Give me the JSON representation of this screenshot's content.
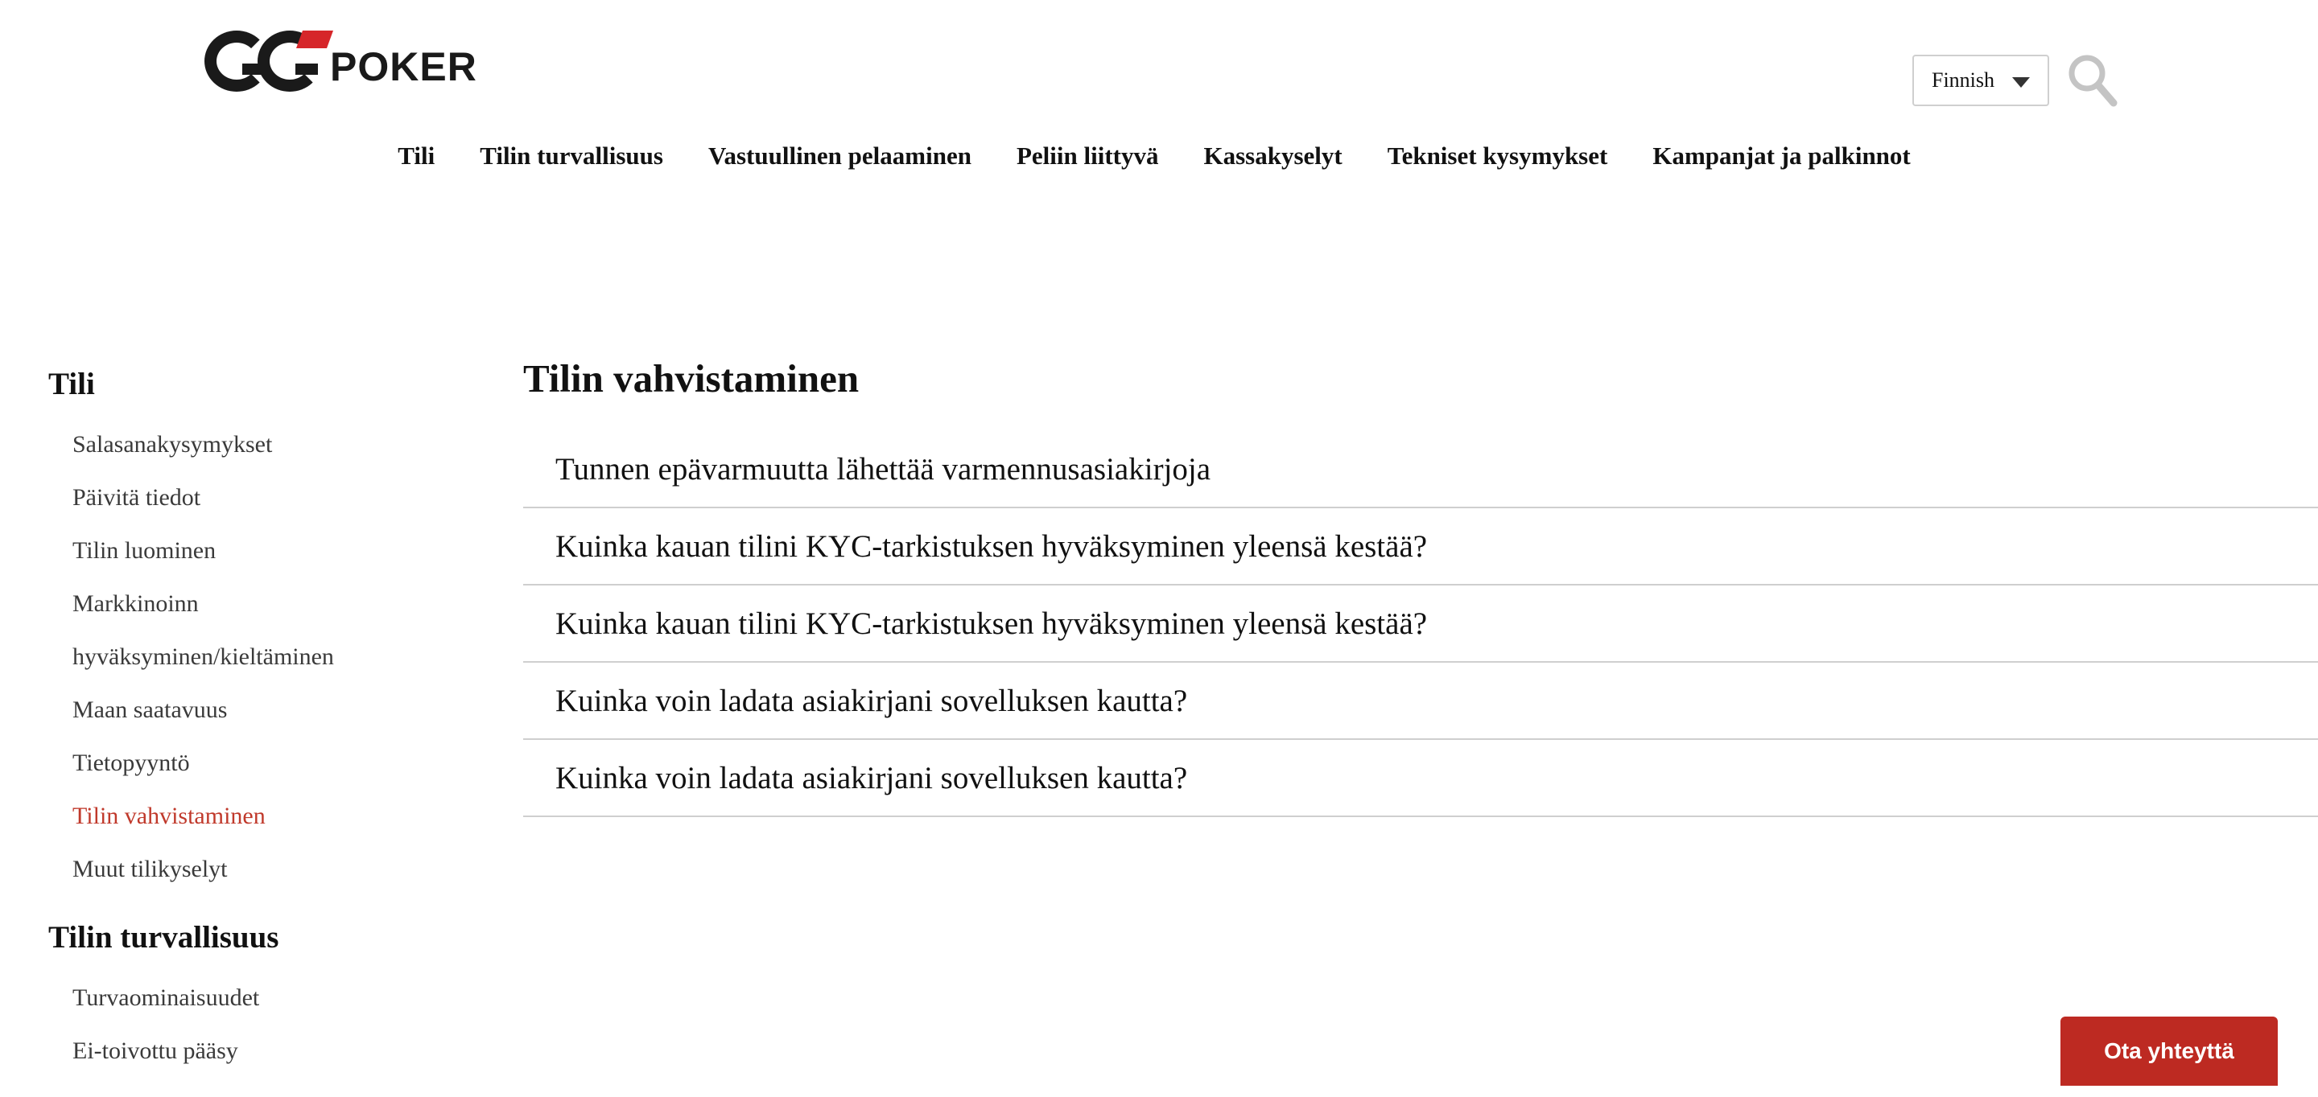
{
  "header": {
    "logo": {
      "text": "POKER",
      "mark": "GG"
    },
    "language": "Finnish",
    "search_icon": "search-icon"
  },
  "nav": [
    {
      "label": "Tili"
    },
    {
      "label": "Tilin turvallisuus"
    },
    {
      "label": "Vastuullinen pelaaminen"
    },
    {
      "label": "Peliin liittyvä"
    },
    {
      "label": "Kassakyselyt"
    },
    {
      "label": "Tekniset kysymykset"
    },
    {
      "label": "Kampanjat ja palkinnot"
    }
  ],
  "sidebar": {
    "groups": [
      {
        "title": "Tili",
        "items": [
          {
            "label": "Salasanakysymykset"
          },
          {
            "label": "Päivitä tiedot"
          },
          {
            "label": "Tilin luominen"
          },
          {
            "label": "Markkinoinn"
          },
          {
            "label": "hyväksyminen/kieltäminen"
          },
          {
            "label": "Maan saatavuus"
          },
          {
            "label": "Tietopyyntö"
          },
          {
            "label": "Tilin vahvistaminen"
          },
          {
            "label": "Muut tilikyselyt"
          }
        ]
      },
      {
        "title": "Tilin turvallisuus",
        "items": [
          {
            "label": "Turvaominaisuudet"
          },
          {
            "label": "Ei-toivottu pääsy"
          }
        ]
      }
    ],
    "active_item": "Tilin vahvistaminen",
    "active_color": "#c0392b"
  },
  "main": {
    "title": "Tilin vahvistaminen",
    "questions": [
      {
        "text": "Tunnen epävarmuutta lähettää varmennusasiakirjoja"
      },
      {
        "text": "Kuinka kauan tilini KYC-tarkistuksen hyväksyminen yleensä kestää?"
      },
      {
        "text": "Kuinka kauan tilini KYC-tarkistuksen hyväksyminen yleensä kestää?"
      },
      {
        "text": "Kuinka voin ladata asiakirjani sovelluksen kautta?"
      },
      {
        "text": "Kuinka voin ladata asiakirjani sovelluksen kautta?"
      }
    ]
  },
  "contact_button": {
    "label": "Ota yhteyttä",
    "color": "#bd2a22"
  }
}
